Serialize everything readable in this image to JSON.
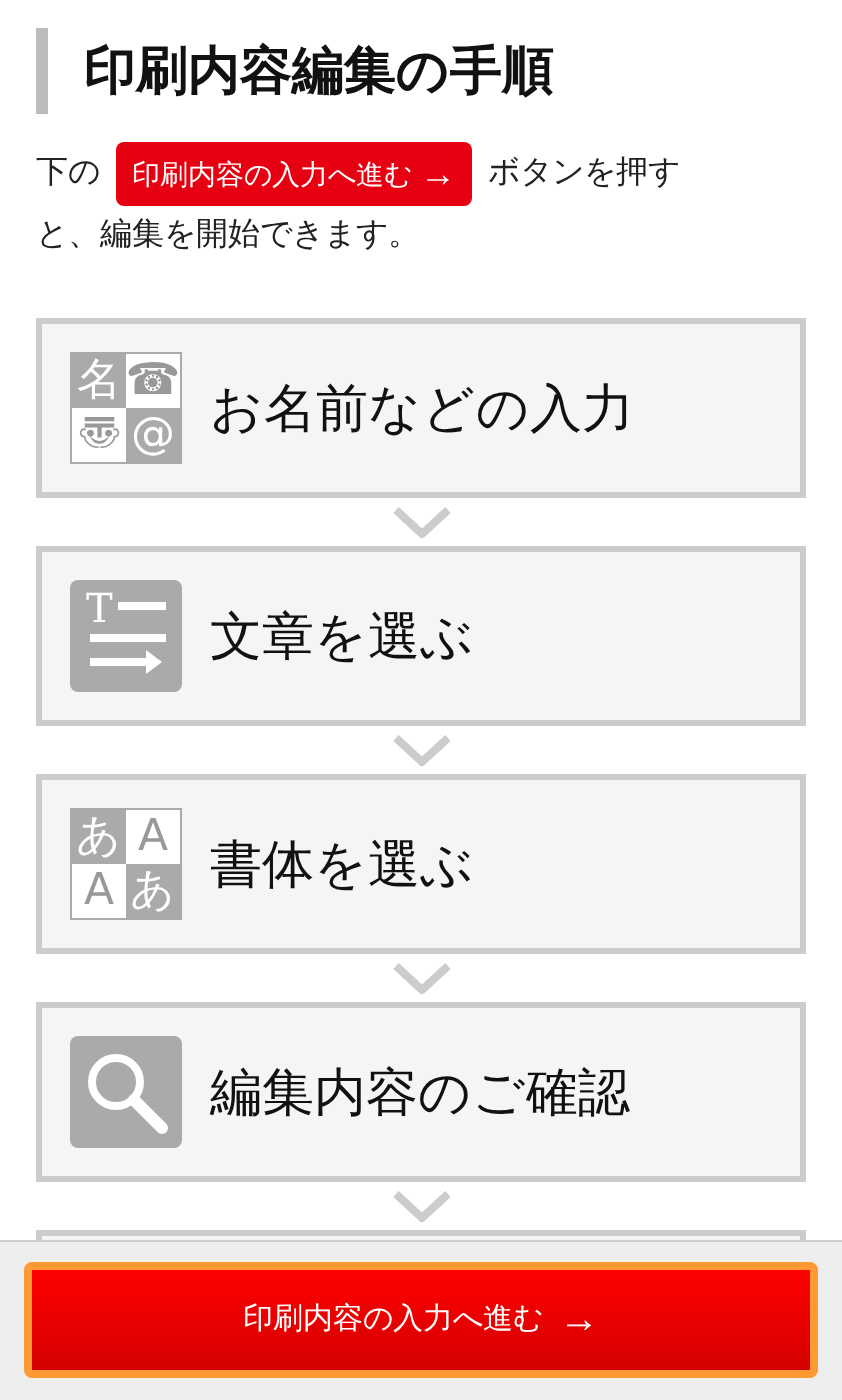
{
  "heading": "印刷内容編集の手順",
  "intro": {
    "before": "下の",
    "button": {
      "label": "印刷内容の入力へ進む",
      "icon": "→"
    },
    "after": [
      "ボタンを押す",
      "と、編集を開始できます。"
    ]
  },
  "steps": [
    {
      "label": "お名前などの入力",
      "icon": {
        "kind": "grid",
        "cells": [
          "名",
          "☎",
          "〠",
          "@"
        ]
      }
    },
    {
      "label": "文章を選ぶ",
      "icon": {
        "kind": "text-lines",
        "cells": [
          "T"
        ]
      }
    },
    {
      "label": "書体を選ぶ",
      "icon": {
        "kind": "grid",
        "cells": [
          "あ",
          "A",
          "A",
          "あ"
        ]
      }
    },
    {
      "label": "編集内容のご確認",
      "icon": {
        "kind": "search"
      }
    }
  ],
  "more_steps_below": true,
  "footer": {
    "button": {
      "label": "印刷内容の入力へ進む",
      "icon": "→"
    }
  }
}
